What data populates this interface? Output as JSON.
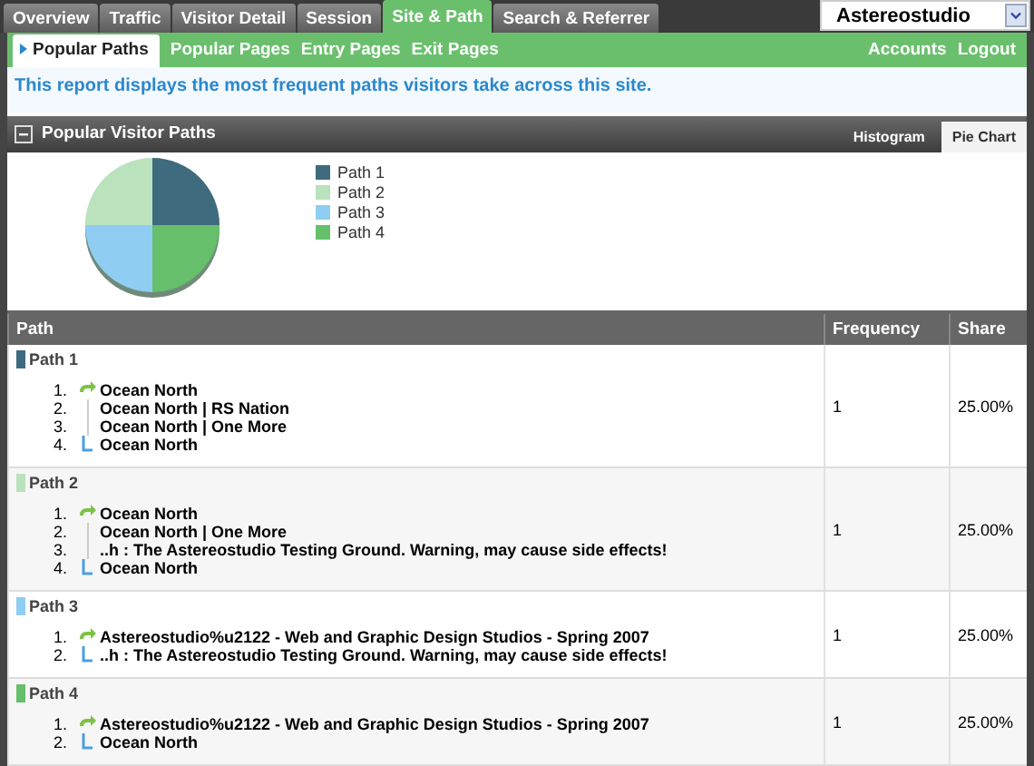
{
  "main_tabs": [
    {
      "label": "Overview",
      "selected": false
    },
    {
      "label": "Traffic",
      "selected": false
    },
    {
      "label": "Visitor Detail",
      "selected": false
    },
    {
      "label": "Session",
      "selected": false
    },
    {
      "label": "Site & Path",
      "selected": true
    },
    {
      "label": "Search & Referrer",
      "selected": false
    }
  ],
  "site_select": {
    "value": "Astereostudio"
  },
  "sub_tabs": [
    {
      "label": "Popular Paths",
      "selected": true
    },
    {
      "label": "Popular Pages",
      "selected": false
    },
    {
      "label": "Entry Pages",
      "selected": false
    },
    {
      "label": "Exit Pages",
      "selected": false
    }
  ],
  "account_links": [
    "Accounts",
    "Logout"
  ],
  "description": "This report displays the most frequent paths visitors take across this site.",
  "panel": {
    "title": "Popular Visitor Paths",
    "view_tabs": [
      {
        "label": "Histogram",
        "selected": false
      },
      {
        "label": "Pie Chart",
        "selected": true
      }
    ],
    "chart_data": {
      "type": "pie",
      "categories": [
        "Path 1",
        "Path 2",
        "Path 3",
        "Path 4"
      ],
      "series": [
        {
          "values": [
            25,
            25,
            25,
            25
          ],
          "colors": [
            "#3e6b7d",
            "#b9e2bd",
            "#8fcdf2",
            "#66bf6a"
          ]
        }
      ]
    }
  },
  "table": {
    "columns": [
      "Path",
      "Frequency",
      "Share"
    ],
    "rows": [
      {
        "name": "Path 1",
        "color": "#3e6b7d",
        "steps": [
          {
            "number": "1.",
            "page": "Ocean North"
          },
          {
            "number": "2.",
            "page": "Ocean North | RS Nation"
          },
          {
            "number": "3.",
            "page": "Ocean North | One More"
          },
          {
            "number": "4.",
            "page": "Ocean North"
          }
        ],
        "frequency": "1",
        "share": "25.00%"
      },
      {
        "name": "Path 2",
        "color": "#b9e2bd",
        "steps": [
          {
            "number": "1.",
            "page": "Ocean North"
          },
          {
            "number": "2.",
            "page": "Ocean North | One More"
          },
          {
            "number": "3.",
            "page": "..h : The Astereostudio Testing Ground. Warning, may cause side effects!"
          },
          {
            "number": "4.",
            "page": "Ocean North"
          }
        ],
        "frequency": "1",
        "share": "25.00%"
      },
      {
        "name": "Path 3",
        "color": "#8fcdf2",
        "steps": [
          {
            "number": "1.",
            "page": "Astereostudio%u2122 - Web and Graphic Design Studios - Spring 2007"
          },
          {
            "number": "2.",
            "page": "..h : The Astereostudio Testing Ground. Warning, may cause side effects!"
          }
        ],
        "frequency": "1",
        "share": "25.00%"
      },
      {
        "name": "Path 4",
        "color": "#66bf6a",
        "steps": [
          {
            "number": "1.",
            "page": "Astereostudio%u2122 - Web and Graphic Design Studios - Spring 2007"
          },
          {
            "number": "2.",
            "page": "Ocean North"
          }
        ],
        "frequency": "1",
        "share": "25.00%"
      }
    ]
  }
}
